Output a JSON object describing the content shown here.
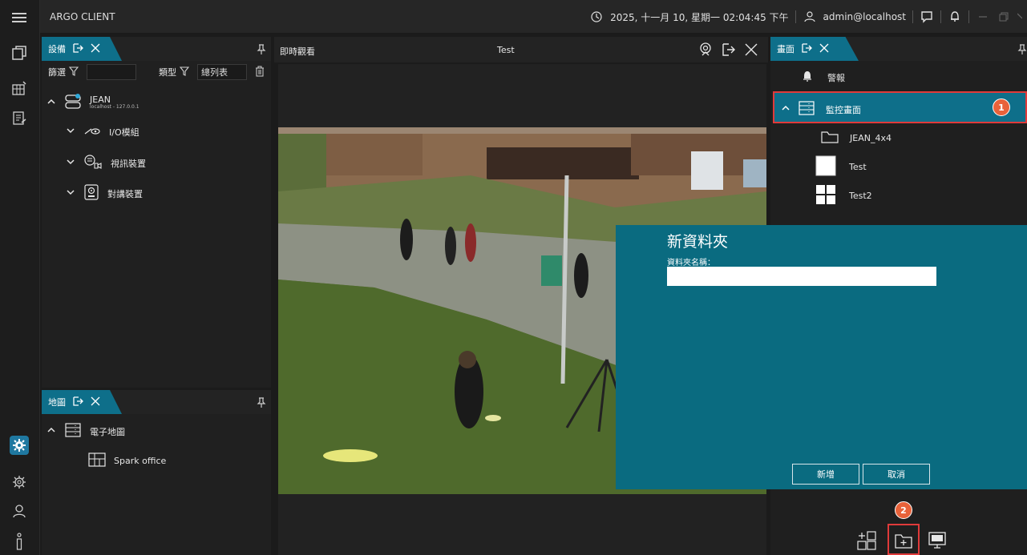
{
  "app": {
    "title": "ARGO CLIENT"
  },
  "topbar": {
    "datetime": "2025, 十一月 10, 星期一 02:04:45 下午",
    "user": "admin@localhost"
  },
  "devices_panel": {
    "tab_label": "設備",
    "filter_label": "篩選",
    "type_label": "類型",
    "type_value": "總列表",
    "server": {
      "name": "JEAN",
      "address": "localhost - 127.0.0.1"
    },
    "groups": [
      {
        "label": "I/O模組",
        "icon": "io-module-icon"
      },
      {
        "label": "視訊裝置",
        "icon": "video-device-icon"
      },
      {
        "label": "對講裝置",
        "icon": "intercom-device-icon"
      }
    ]
  },
  "maps_panel": {
    "tab_label": "地圖",
    "root_label": "電子地圖",
    "items": [
      {
        "label": "Spark office",
        "icon": "floorplan-icon"
      }
    ]
  },
  "live_view": {
    "title": "即時觀看",
    "layout_name": "Test"
  },
  "screens_panel": {
    "tab_label": "畫面",
    "alarm_label": "警報",
    "selected_label": "監控畫面",
    "items": [
      {
        "label": "JEAN_4x4",
        "icon": "folder-icon"
      },
      {
        "label": "Test",
        "icon": "single-layout-icon"
      },
      {
        "label": "Test2",
        "icon": "quad-layout-icon"
      }
    ]
  },
  "dialog": {
    "title": "新資料夾",
    "field_label": "資料夾名稱：",
    "field_value": "",
    "confirm_label": "新增",
    "cancel_label": "取消"
  },
  "badges": {
    "one": "1",
    "two": "2"
  },
  "colors": {
    "accent": "#0e6f8a",
    "highlight": "#e03a3a",
    "badge": "#e8623a"
  }
}
